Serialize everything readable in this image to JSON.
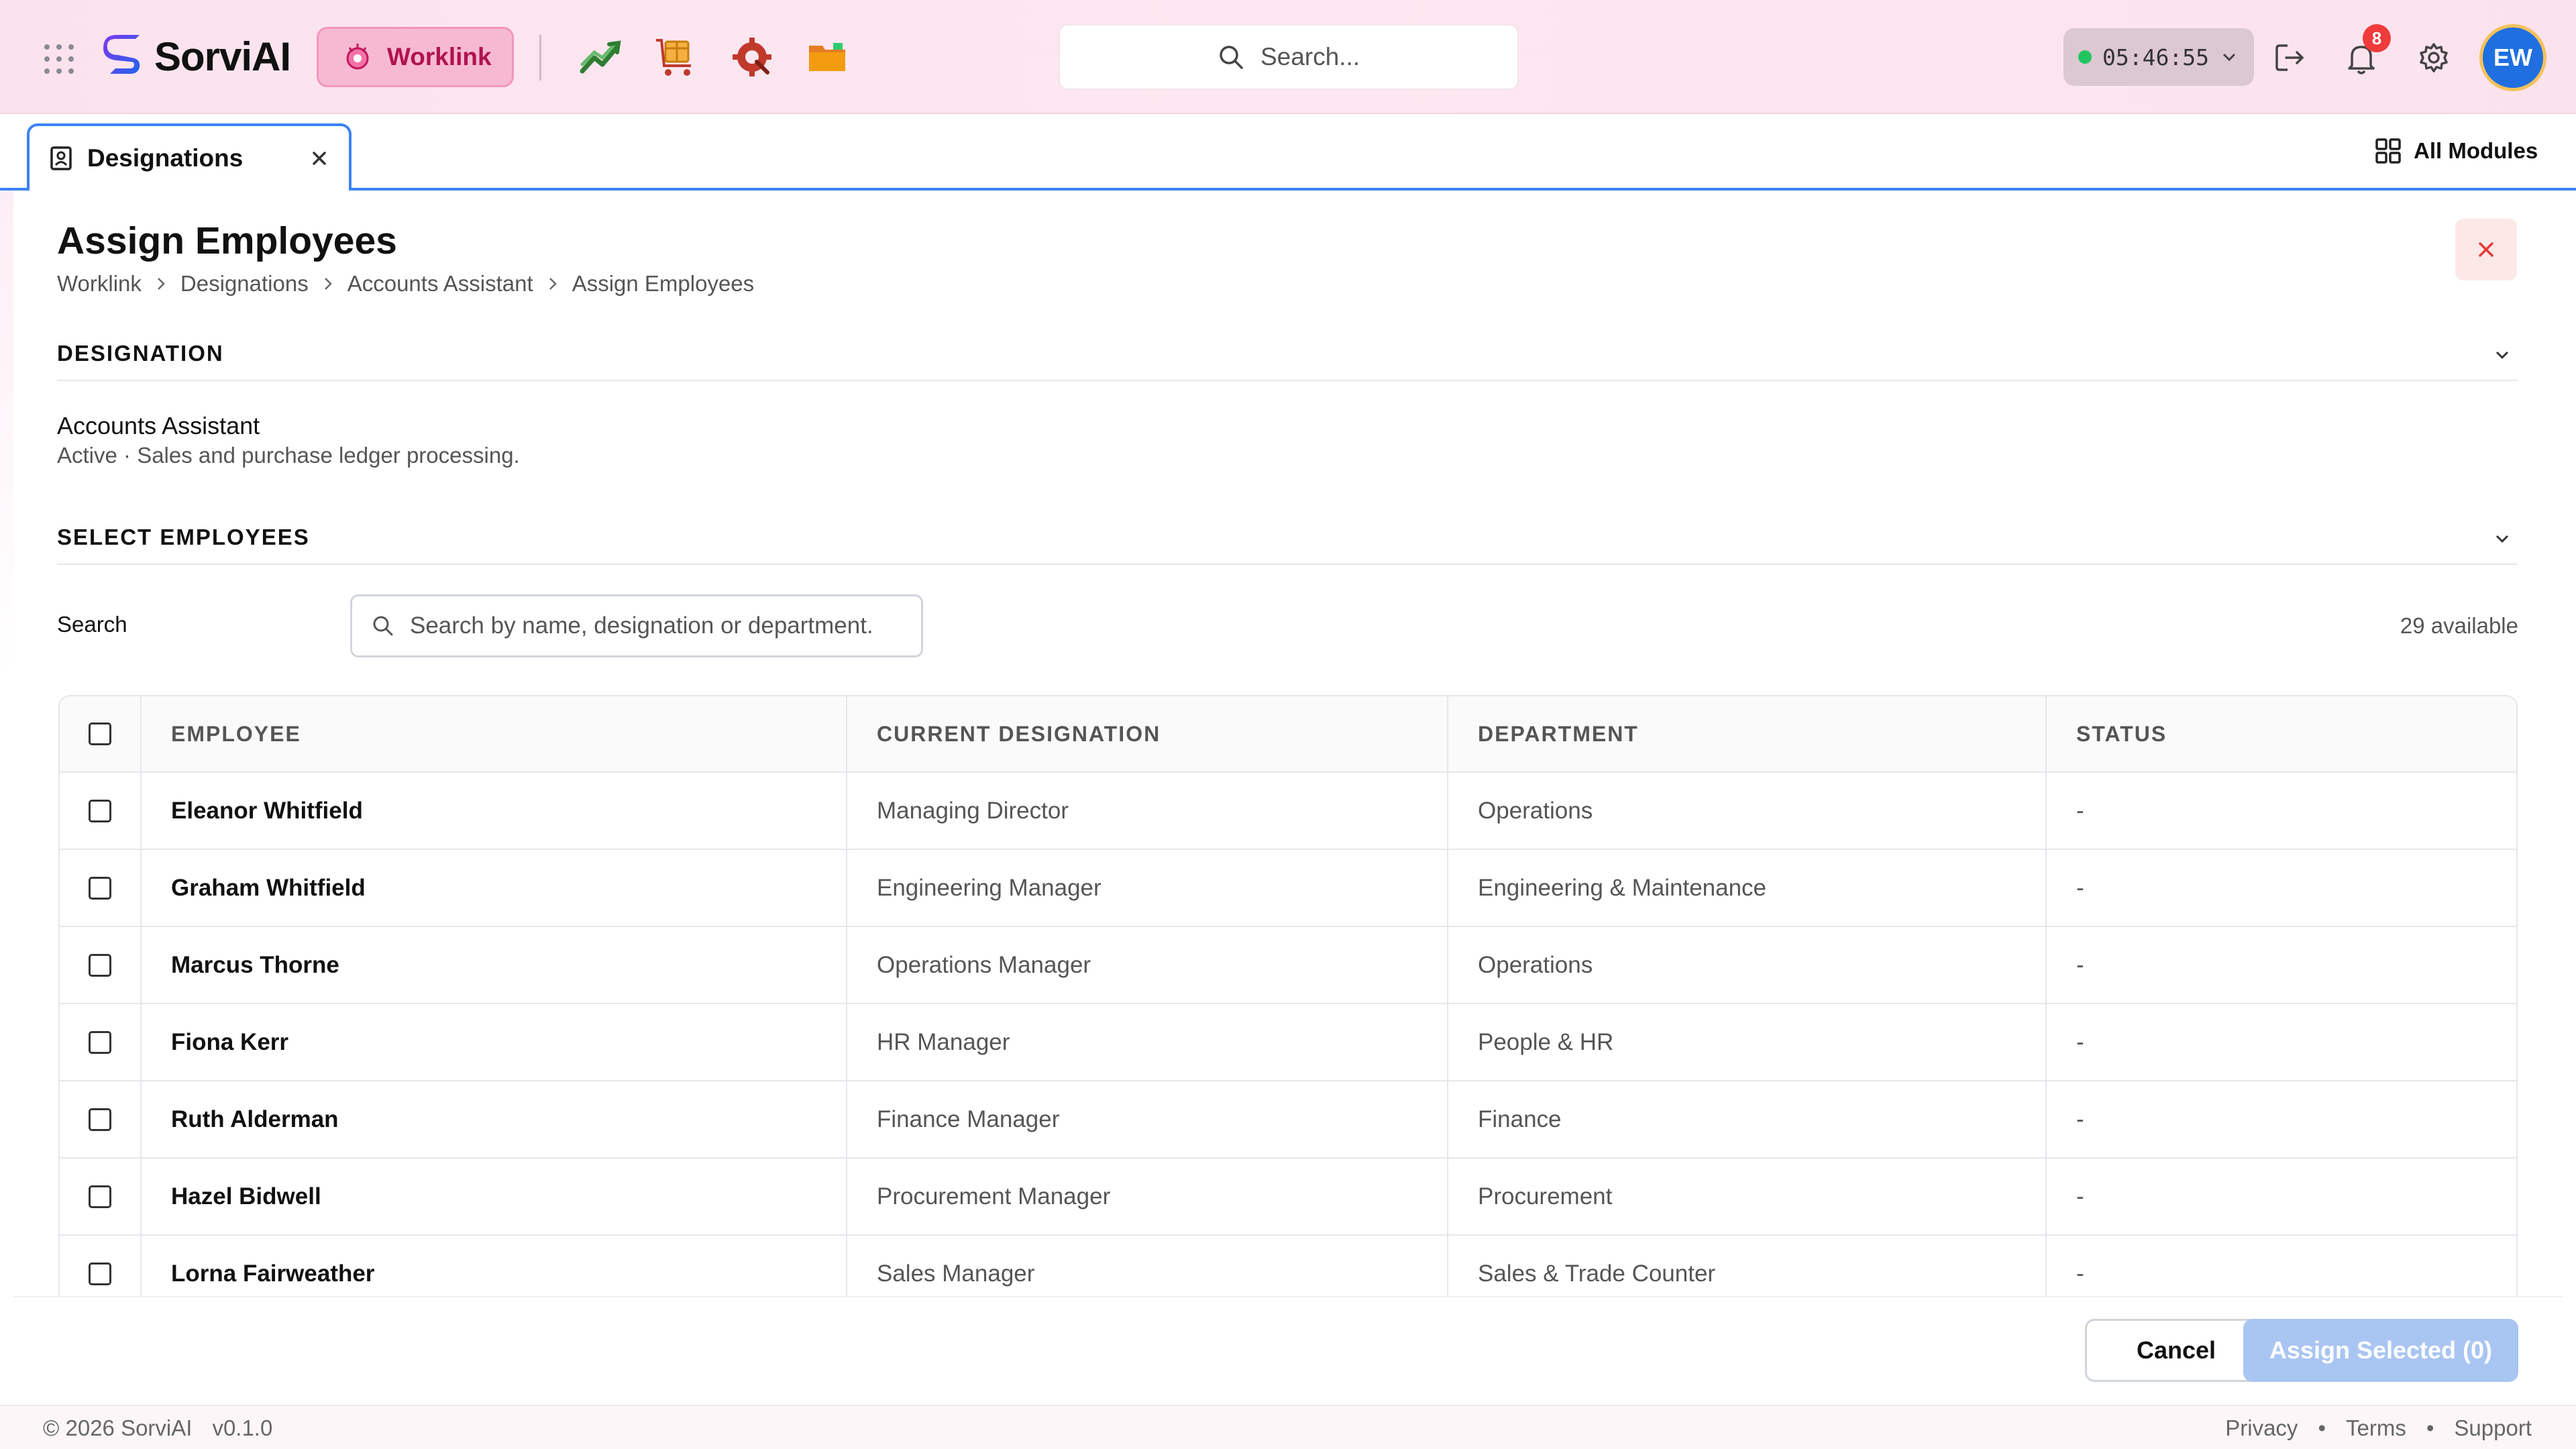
{
  "topbar": {
    "brand": "SorviAI",
    "active_app": "Worklink",
    "search_placeholder": "Search...",
    "clock": "05:46:55",
    "notification_count": "8",
    "avatar_initials": "EW",
    "module_icons": [
      "analytics-icon",
      "inventory-icon",
      "service-icon",
      "folder-icon"
    ]
  },
  "tabs": {
    "active": "Designations",
    "all_modules": "All Modules"
  },
  "page": {
    "title": "Assign Employees",
    "breadcrumb": [
      "Worklink",
      "Designations",
      "Accounts Assistant",
      "Assign Employees"
    ]
  },
  "designation_section": {
    "heading": "DESIGNATION",
    "name": "Accounts Assistant",
    "description": "Active · Sales and purchase ledger processing."
  },
  "employees_section": {
    "heading": "SELECT EMPLOYEES",
    "search_label": "Search",
    "search_placeholder": "Search by name, designation or department.",
    "available": "29 available",
    "columns": [
      "EMPLOYEE",
      "CURRENT DESIGNATION",
      "DEPARTMENT",
      "STATUS"
    ],
    "rows": [
      {
        "name": "Eleanor Whitfield",
        "designation": "Managing Director",
        "department": "Operations",
        "status": "-"
      },
      {
        "name": "Graham Whitfield",
        "designation": "Engineering Manager",
        "department": "Engineering & Maintenance",
        "status": "-"
      },
      {
        "name": "Marcus Thorne",
        "designation": "Operations Manager",
        "department": "Operations",
        "status": "-"
      },
      {
        "name": "Fiona Kerr",
        "designation": "HR Manager",
        "department": "People & HR",
        "status": "-"
      },
      {
        "name": "Ruth Alderman",
        "designation": "Finance Manager",
        "department": "Finance",
        "status": "-"
      },
      {
        "name": "Hazel Bidwell",
        "designation": "Procurement Manager",
        "department": "Procurement",
        "status": "-"
      },
      {
        "name": "Lorna Fairweather",
        "designation": "Sales Manager",
        "department": "Sales & Trade Counter",
        "status": "-"
      }
    ]
  },
  "actions": {
    "cancel": "Cancel",
    "assign": "Assign Selected (0)"
  },
  "footer": {
    "copyright": "© 2026 SorviAI",
    "version": "v0.1.0",
    "links": [
      "Privacy",
      "Terms",
      "Support"
    ]
  },
  "colors": {
    "accent": "#3b82f6",
    "worklink": "#b0124f",
    "danger": "#ef3b3b",
    "online": "#22c55e"
  }
}
